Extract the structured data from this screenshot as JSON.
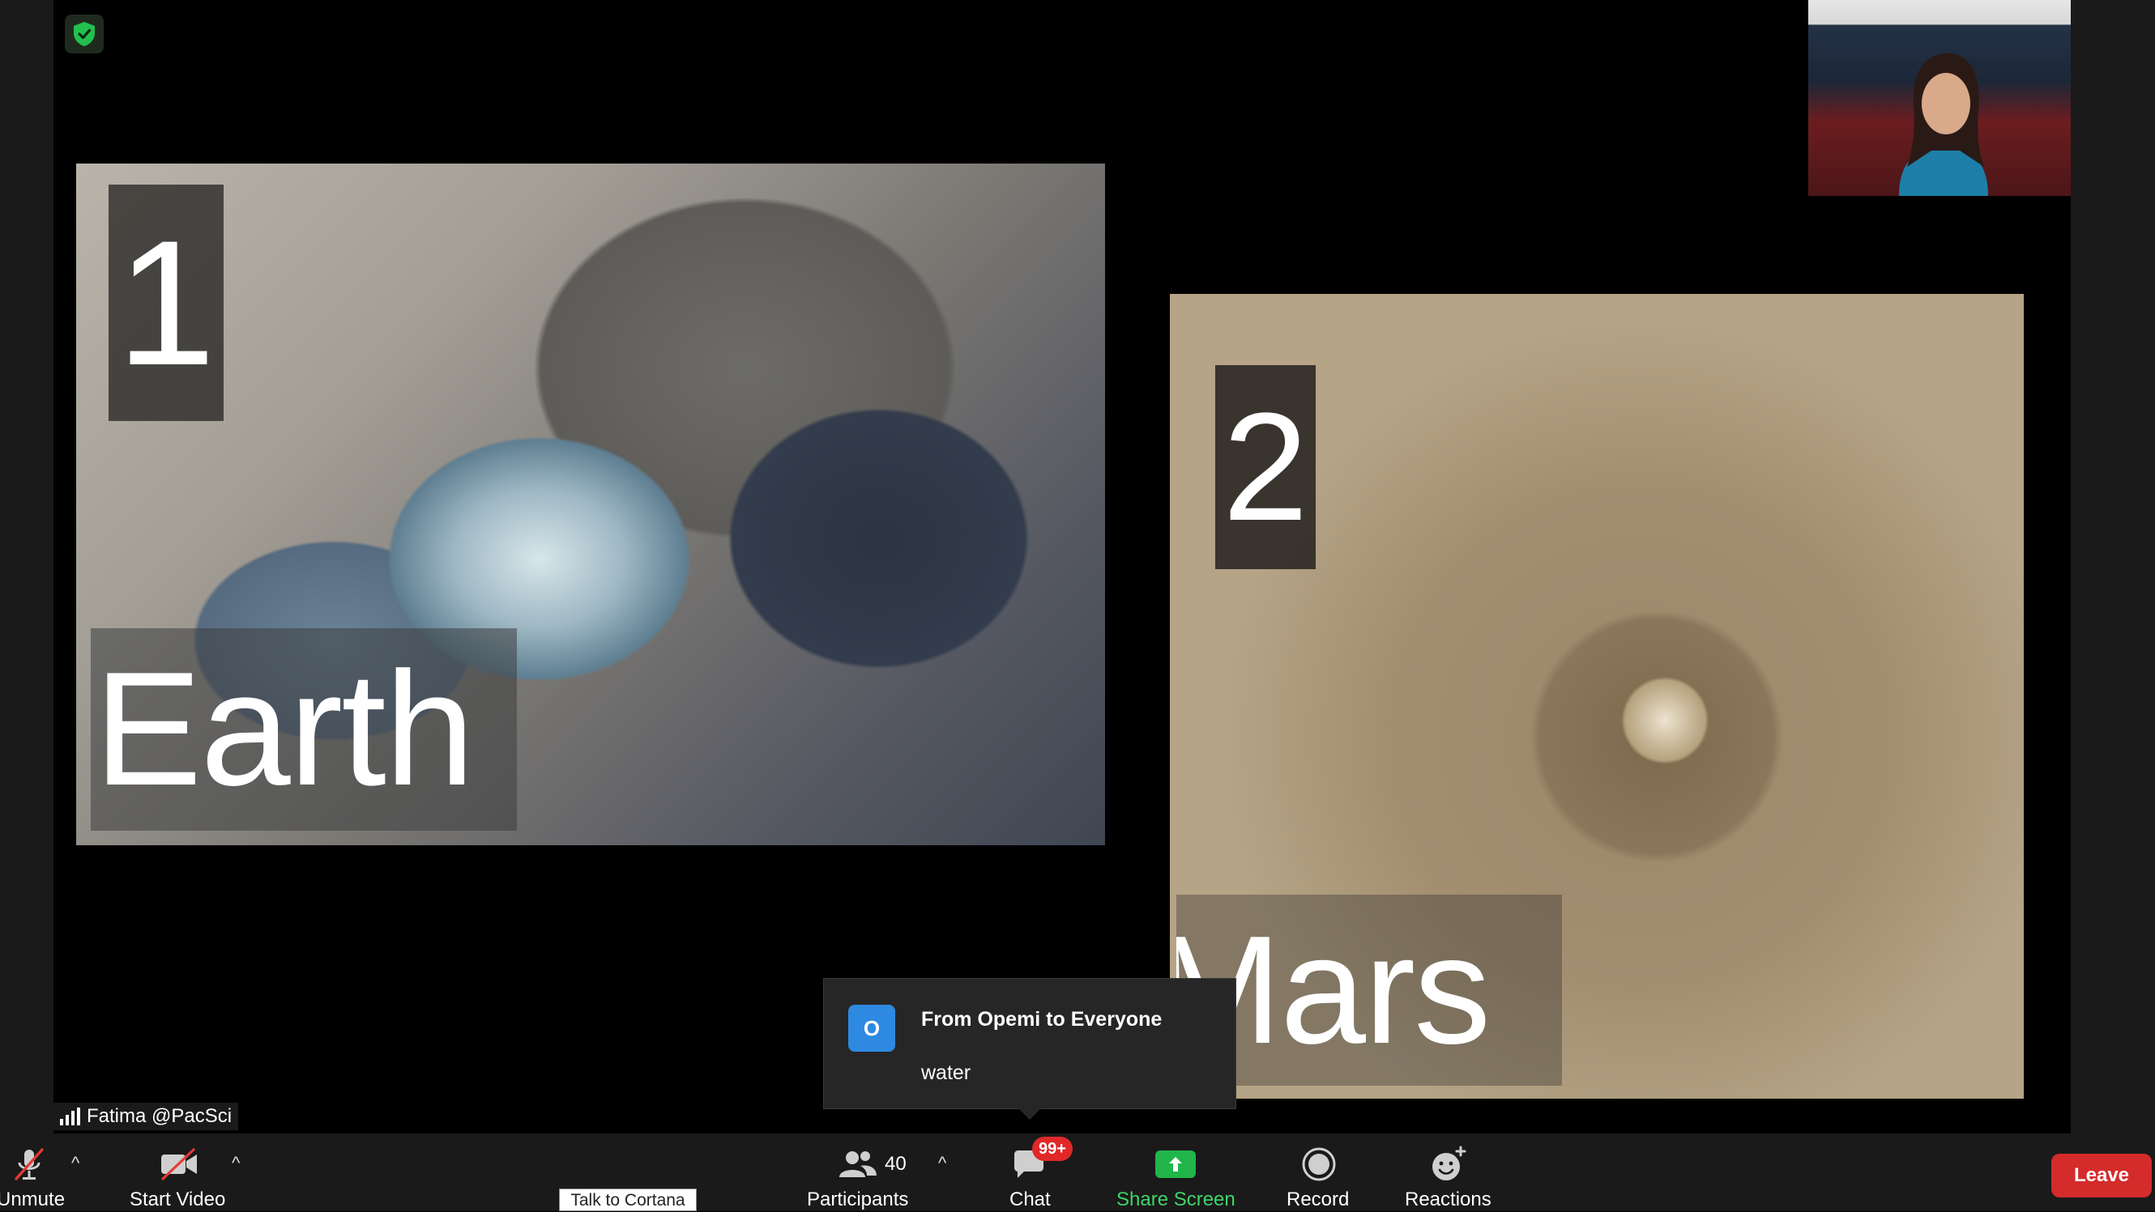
{
  "share": {
    "earth": {
      "number": "1",
      "label": "Earth"
    },
    "mars": {
      "number": "2",
      "label": "Mars"
    }
  },
  "participant_name": "Fatima @PacSci",
  "chat_toast": {
    "avatar_initial": "O",
    "from": "From Opemi to Everyone",
    "message": "water"
  },
  "toolbar": {
    "unmute_label": "Unmute",
    "start_video_label": "Start Video",
    "participants_label": "Participants",
    "participants_count": "40",
    "chat_label": "Chat",
    "chat_badge": "99+",
    "share_screen_label": "Share Screen",
    "record_label": "Record",
    "reactions_label": "Reactions",
    "leave_label": "Leave"
  },
  "taskbar_tooltip": "Talk to Cortana",
  "colors": {
    "accent_green": "#20b64a",
    "leave_red": "#d42b2b",
    "badge_red": "#e02828",
    "avatar_blue": "#2d8ae0"
  },
  "icons": [
    "shield-check-icon",
    "signal-icon",
    "microphone-muted-icon",
    "video-off-icon",
    "participants-icon",
    "chat-icon",
    "share-screen-arrow-icon",
    "record-icon",
    "reactions-icon"
  ]
}
